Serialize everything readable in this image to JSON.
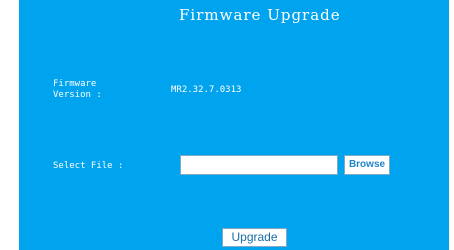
{
  "page": {
    "title": "Firmware Upgrade"
  },
  "firmware": {
    "label_line1": "Firmware",
    "label_line2": "Version :",
    "value": "MR2.32.7.0313"
  },
  "file_select": {
    "label": "Select File :",
    "value": "",
    "browse_label": "Browse"
  },
  "actions": {
    "upgrade_label": "Upgrade"
  },
  "colors": {
    "panel_background": "#00a3ee",
    "text": "#ffffff",
    "button_text": "#1f86c8"
  }
}
